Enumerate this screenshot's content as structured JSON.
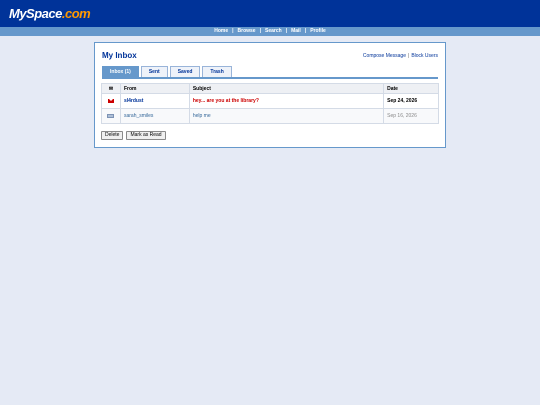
{
  "header": {
    "logo_main": "MySpace",
    "logo_accent": ".com"
  },
  "nav": {
    "items": [
      "Home",
      "Browse",
      "Search",
      "Mail",
      "Profile"
    ],
    "separator": "|"
  },
  "inbox": {
    "title": "My Inbox",
    "compose_link": "Compose Message",
    "block_link": "Block Users",
    "link_separator": "|",
    "tabs": [
      {
        "label": "Inbox (1)",
        "active": true
      },
      {
        "label": "Sent",
        "active": false
      },
      {
        "label": "Saved",
        "active": false
      },
      {
        "label": "Trash",
        "active": false
      }
    ],
    "columns": {
      "icon": "✉",
      "from": "From",
      "subject": "Subject",
      "date": "Date"
    },
    "messages": [
      {
        "from": "sl4rdust",
        "subject": "hey... are you at the library?",
        "date": "Sep 24, 2026",
        "unread": true
      },
      {
        "from": "sarah_smiles",
        "subject": "help me",
        "date": "Sep 16, 2026",
        "unread": false
      }
    ],
    "buttons": {
      "delete": "Delete",
      "mark_read": "Mark as Read"
    }
  },
  "colors": {
    "header_bg": "#003399",
    "nav_bg": "#6698cb",
    "logo_accent": "#ff9900",
    "unread_subject": "#cc0000",
    "page_bg": "#e5eaf5"
  }
}
